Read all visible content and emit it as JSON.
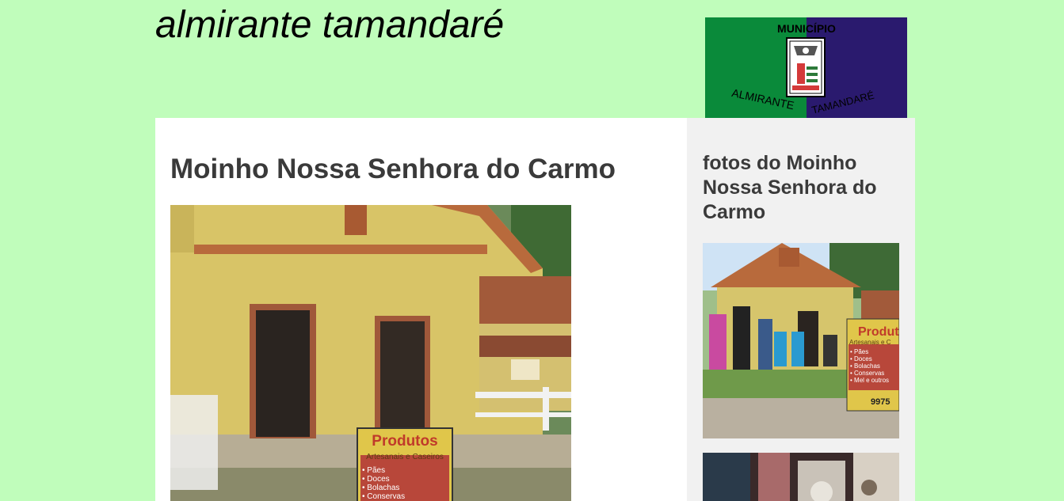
{
  "header": {
    "site_title": "almirante tamandaré",
    "flag": {
      "top_text": "MUNICÍPIO",
      "bottom_left_text": "ALMIRANTE",
      "bottom_right_text": "TAMANDARÉ",
      "left_color": "#0a8a3a",
      "right_color": "#2a1a6e"
    }
  },
  "main": {
    "post_title": "Moinho Nossa Senhora do Carmo",
    "photo": {
      "sign_title": "Produtos",
      "sign_subtitle": "Artesanais e Caseiros",
      "sign_items": [
        "• Pães",
        "• Doces",
        "• Bolachas",
        "• Conservas"
      ]
    }
  },
  "sidebar": {
    "widget_title": "fotos do Moinho Nossa Senhora do Carmo",
    "thumb1": {
      "sign_title": "Produt",
      "sign_subtitle": "Artesanais e C",
      "sign_items": [
        "• Pães",
        "• Doces",
        "• Bolachas",
        "• Conservas",
        "• Mel e outros"
      ],
      "sign_phone": "9975"
    }
  },
  "colors": {
    "page_background": "#c0fdbb",
    "content_background": "#ffffff",
    "sidebar_background": "#f1f1f1",
    "heading_color": "#3a3a3a"
  }
}
